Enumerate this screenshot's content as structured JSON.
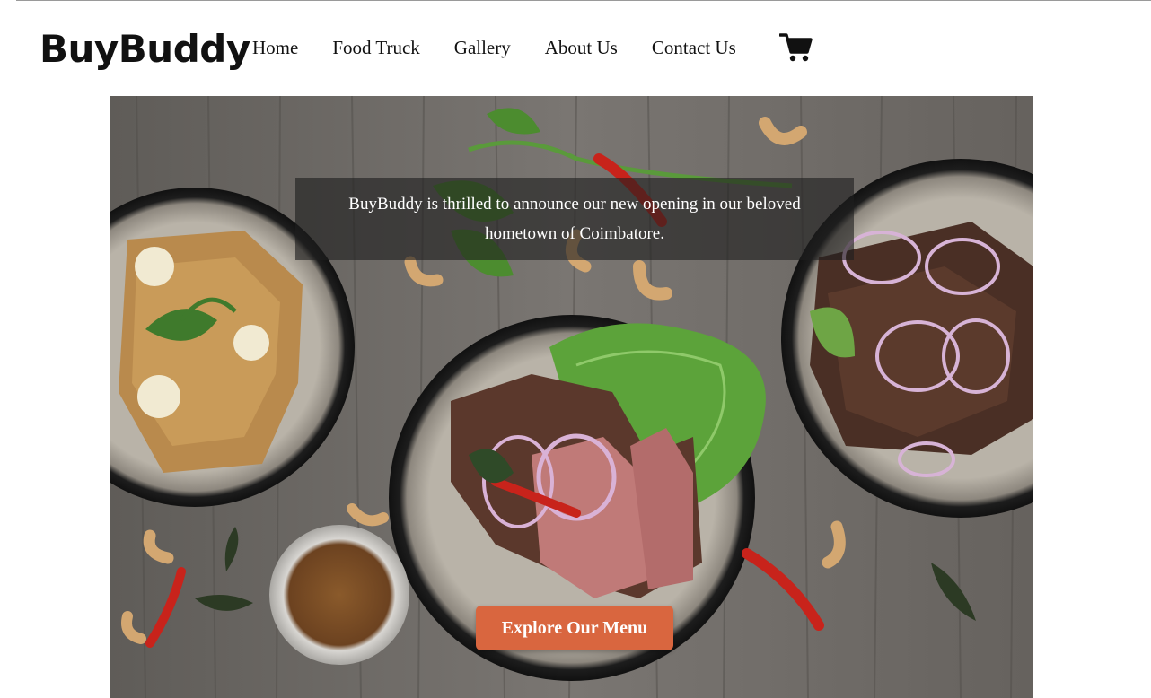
{
  "brand": {
    "name": "BuyBuddy"
  },
  "nav": {
    "items": [
      {
        "label": "Home"
      },
      {
        "label": "Food Truck"
      },
      {
        "label": "Gallery"
      },
      {
        "label": "About Us"
      },
      {
        "label": "Contact Us"
      }
    ],
    "cart_icon": "shopping-cart-icon"
  },
  "hero": {
    "announcement": "BuyBuddy is thrilled to announce our new opening in our beloved hometown of Coimbatore.",
    "cta_label": "Explore Our Menu",
    "cta_color": "#d9663f",
    "image": "food-bowls-on-wooden-table"
  }
}
